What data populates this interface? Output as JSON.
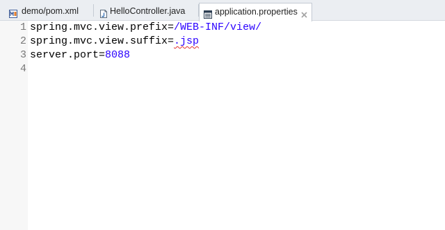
{
  "tabs": [
    {
      "label": "demo/pom.xml",
      "icon": "maven-xml-icon",
      "active": false
    },
    {
      "label": "HelloController.java",
      "icon": "java-file-icon",
      "active": false
    },
    {
      "label": "application.properties",
      "icon": "properties-file-icon",
      "active": true,
      "close_icon": "close-icon"
    }
  ],
  "editor": {
    "line_numbers": [
      "1",
      "2",
      "3",
      "4"
    ],
    "lines": [
      {
        "key": "spring.mvc.view.prefix=",
        "value": "/WEB-INF/view/"
      },
      {
        "key": "spring.mvc.view.suffix=",
        "value": ".jsp"
      },
      {
        "key": "server.port=",
        "value": "8088"
      },
      {
        "key": "",
        "value": ""
      }
    ]
  },
  "colors": {
    "value_text": "#2a00ff",
    "key_text": "#000000",
    "line_number": "#787878",
    "tab_bar": "#ebeef2",
    "spell_error": "#e03030"
  }
}
